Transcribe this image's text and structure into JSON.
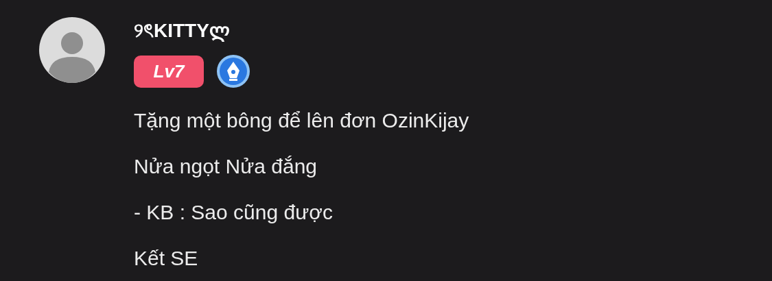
{
  "comment": {
    "username": "୨ৎKITTYლ",
    "level_badge": "Lv7",
    "lines": [
      "Tặng một bông để lên đơn OzinKijay",
      "Nửa ngọt Nửa đắng",
      "- KB : Sao cũng được",
      "Kết SE"
    ]
  }
}
